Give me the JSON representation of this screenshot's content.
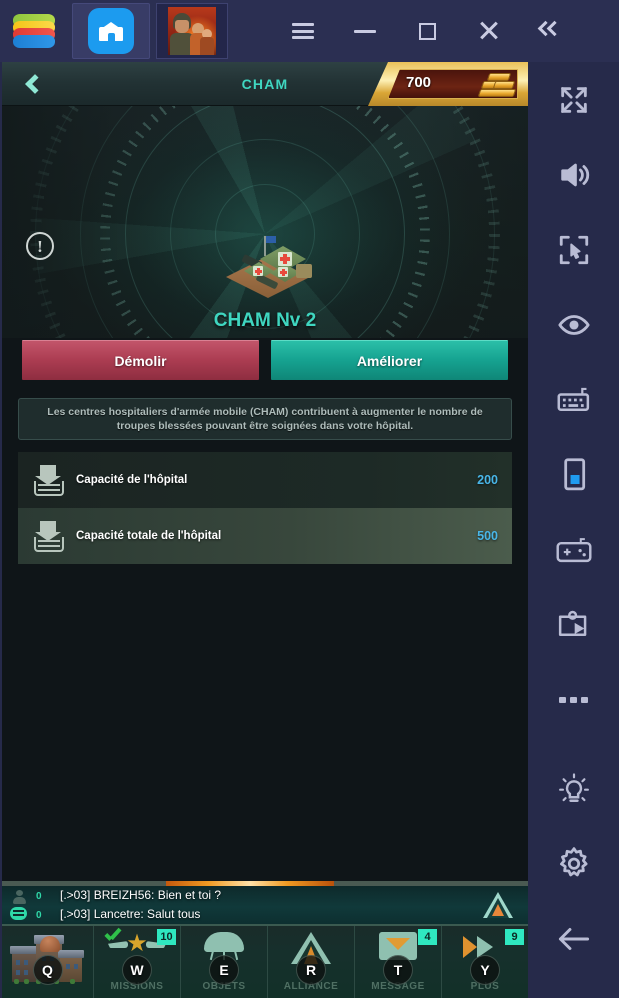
{
  "emulator": {
    "name": "bluestacks-logo",
    "tabs": [
      {
        "name": "home-tab",
        "icon": "home-icon"
      },
      {
        "name": "game-tab",
        "icon": "game-thumbnail"
      }
    ],
    "window_controls": [
      {
        "name": "menu-button",
        "icon": "hamburger-icon"
      },
      {
        "name": "minimize-button",
        "icon": "minus-icon"
      },
      {
        "name": "maximize-button",
        "icon": "square-icon"
      },
      {
        "name": "close-button",
        "icon": "close-x-icon"
      },
      {
        "name": "collapse-sidebar-button",
        "icon": "double-chevron-left-icon"
      }
    ],
    "sidebar": [
      {
        "name": "fullscreen",
        "icon": "fullscreen-expand-icon"
      },
      {
        "name": "volume",
        "icon": "speaker-volume-icon"
      },
      {
        "name": "cursor-control",
        "icon": "cursor-target-icon"
      },
      {
        "name": "eye-view",
        "icon": "eye-icon"
      },
      {
        "name": "keyboard-controls",
        "icon": "keyboard-icon"
      },
      {
        "name": "rotate-screen",
        "icon": "phone-portrait-icon"
      },
      {
        "name": "gamepad",
        "icon": "gamepad-icon"
      },
      {
        "name": "screen-record",
        "icon": "screen-record-icon"
      },
      {
        "name": "more-options",
        "icon": "more-dots-icon"
      },
      {
        "name": "tips",
        "icon": "lightbulb-icon"
      },
      {
        "name": "settings",
        "icon": "gear-icon"
      },
      {
        "name": "back",
        "icon": "arrow-left-icon"
      }
    ]
  },
  "game": {
    "header": {
      "back_icon": "chevron-left-icon",
      "title": "CHAM",
      "gold_value": "700",
      "gold_icon": "gold-bars-icon"
    },
    "warning_icon": "exclamation-circle-icon",
    "building": {
      "art": "field-hospital-tents",
      "name": "CHAM Nv 2"
    },
    "actions": {
      "demolish": "Démolir",
      "upgrade": "Améliorer"
    },
    "description": "Les centres hospitaliers d'armée mobile (CHAM) contribuent à augmenter le nombre de troupes blessées pouvant être soignées dans votre hôpital.",
    "stats": [
      {
        "icon": "capacity-arrow-icon",
        "label": "Capacité de l'hôpital",
        "value": "200"
      },
      {
        "icon": "capacity-arrow-icon",
        "label": "Capacité totale de l'hôpital",
        "value": "500"
      }
    ],
    "chat": {
      "player_icon": "person-icon",
      "player_count": "0",
      "message_icon": "chat-bubble-icon",
      "message_count": "0",
      "lines": [
        "[.>03] BREIZH56: Bien et toi ?",
        "[.>03] Lancetre: Salut tous"
      ],
      "alliance_emblem": "alliance-triangle-emblem"
    },
    "nav": [
      {
        "name": "city",
        "icon": "city-buildings-icon",
        "label": "",
        "key": "Q",
        "badge": ""
      },
      {
        "name": "missions",
        "icon": "wings-star-icon",
        "label": "MISSIONS",
        "key": "W",
        "badge": "10"
      },
      {
        "name": "items",
        "icon": "parachute-icon",
        "label": "OBJETS",
        "key": "E",
        "badge": ""
      },
      {
        "name": "alliance",
        "icon": "alliance-icon",
        "label": "ALLIANCE",
        "key": "R",
        "badge": ""
      },
      {
        "name": "message",
        "icon": "envelope-icon",
        "label": "MESSAGE",
        "key": "T",
        "badge": "4"
      },
      {
        "name": "more",
        "icon": "double-chevron-right-icon",
        "label": "PLUS",
        "key": "Y",
        "badge": "9"
      }
    ]
  },
  "colors": {
    "accent_teal": "#3fd6c0",
    "demolish_red": "#ac3d52",
    "upgrade_teal": "#16a391",
    "stat_value_blue": "#49b6e8",
    "badge_green": "#2fe8c0",
    "gold": "#e9c158"
  }
}
